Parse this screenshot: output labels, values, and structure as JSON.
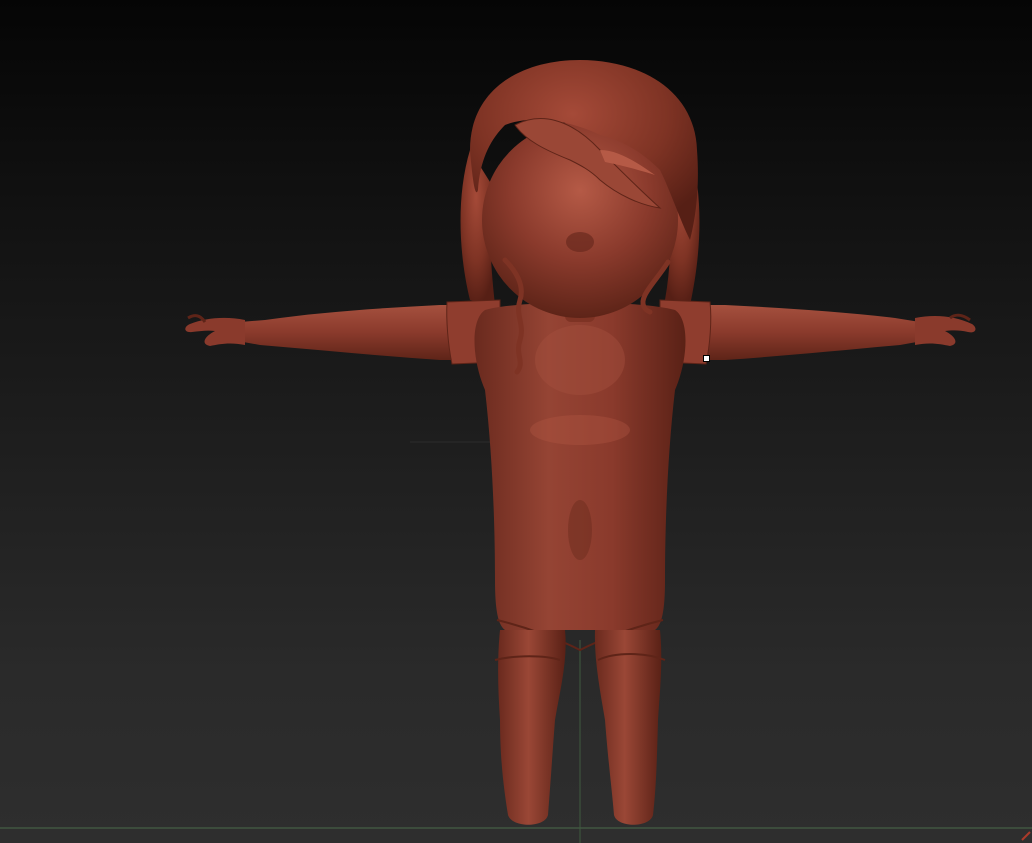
{
  "viewport": {
    "background_top": "#050505",
    "background_bottom": "#2e2e2e",
    "ground_line_color": "#4a6b4a",
    "axis_line_color": "#3f5a3f"
  },
  "model": {
    "material_color": "#8a3a2c",
    "material_dark": "#5e2418",
    "material_light": "#b55a46",
    "pose": "T-pose",
    "icon": "character-sculpt"
  },
  "cursor": {
    "icon": "brush-cursor-icon"
  }
}
